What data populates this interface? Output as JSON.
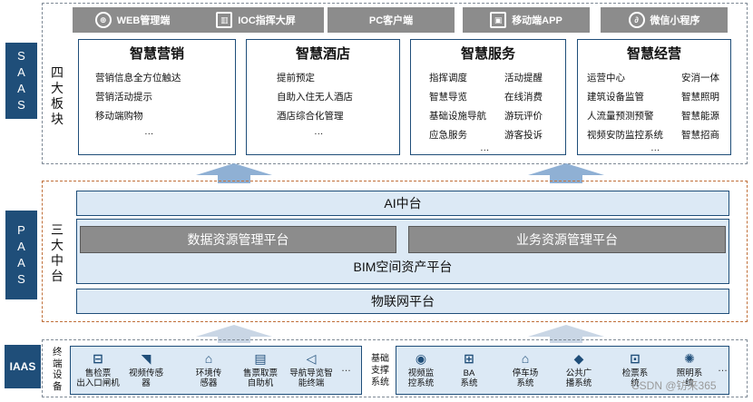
{
  "saas": {
    "tag": [
      "S",
      "A",
      "A",
      "S"
    ],
    "side_label": [
      "四",
      "大",
      "板",
      "块"
    ],
    "channels": [
      {
        "label": "WEB管理端",
        "icon": "globe-icon",
        "glyph": "⊕"
      },
      {
        "label": "IOC指挥大屏",
        "icon": "dashboard-icon",
        "glyph": "▥"
      },
      {
        "label": "PC客户端",
        "icon": "",
        "glyph": ""
      },
      {
        "label": "移动端APP",
        "icon": "app-icon",
        "glyph": "▣"
      },
      {
        "label": "微信小程序",
        "icon": "mini-program-icon",
        "glyph": "∂"
      }
    ],
    "boards": [
      {
        "title": "智慧营销",
        "col1": [
          "营销信息全方位触达",
          "营销活动提示",
          "移动端购物",
          "…"
        ],
        "col2": []
      },
      {
        "title": "智慧酒店",
        "col1": [
          "提前预定",
          "自助入住无人酒店",
          "酒店综合化管理",
          "…"
        ],
        "col2": []
      },
      {
        "title": "智慧服务",
        "col1": [
          "指挥调度",
          "智慧导览",
          "基础设施导航",
          "应急服务"
        ],
        "col2": [
          "活动提醒",
          "在线消费",
          "游玩评价",
          "游客投诉"
        ],
        "more": "…"
      },
      {
        "title": "智慧经营",
        "col1": [
          "运营中心",
          "建筑设备监管",
          "人流量预测预警",
          "视频安防监控系统"
        ],
        "col2": [
          "安消一体",
          "智慧照明",
          "智慧能源",
          "智慧招商"
        ],
        "more": "…"
      }
    ]
  },
  "paas": {
    "tag": [
      "P",
      "A",
      "A",
      "S"
    ],
    "side_label": [
      "三",
      "大",
      "中",
      "台"
    ],
    "ai": "AI中台",
    "data_platform": "数据资源管理平台",
    "biz_platform": "业务资源管理平台",
    "bim": "BIM空间资产平台",
    "iot": "物联网平台"
  },
  "iaas": {
    "tag": "IAAS",
    "terminal_label": [
      "终",
      "端",
      "设",
      "备"
    ],
    "terminals": [
      {
        "label": "售检票\n出入口闸机",
        "icon": "gate-icon",
        "glyph": "⊟"
      },
      {
        "label": "视频传感\n器",
        "icon": "camera-icon",
        "glyph": "◥"
      },
      {
        "label": "环境传\n感器",
        "icon": "sensor-icon",
        "glyph": "⌂"
      },
      {
        "label": "售票取票\n自助机",
        "icon": "kiosk-icon",
        "glyph": "▤"
      },
      {
        "label": "导航导览智\n能终端",
        "icon": "navigation-icon",
        "glyph": "◁"
      }
    ],
    "more1": "…",
    "infra_label": [
      "基础",
      "支撑",
      "系统"
    ],
    "infra": [
      {
        "label": "视频监\n控系统",
        "icon": "monitor-icon",
        "glyph": "◉"
      },
      {
        "label": "BA\n系统",
        "icon": "network-icon",
        "glyph": "⊞"
      },
      {
        "label": "停车场\n系统",
        "icon": "parking-icon",
        "glyph": "⌂"
      },
      {
        "label": "公共广\n播系统",
        "icon": "broadcast-icon",
        "glyph": "◆"
      },
      {
        "label": "检票系\n统",
        "icon": "ticket-icon",
        "glyph": "⊡"
      },
      {
        "label": "照明系\n统",
        "icon": "light-icon",
        "glyph": "✺"
      }
    ],
    "more2": "…"
  },
  "watermark": "CSDN @钫来365"
}
